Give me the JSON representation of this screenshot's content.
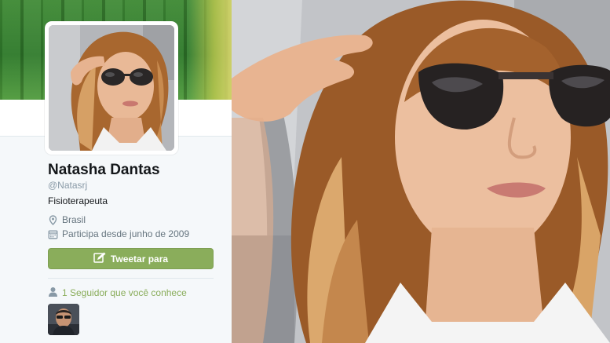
{
  "profile": {
    "name": "Natasha Dantas",
    "handle": "@Natasrj",
    "bio": "Fisioterapeuta",
    "location": "Brasil",
    "joined": "Participa desde junho de 2009",
    "tweet_button_label": "Tweetar para",
    "followers_you_know": "1 Seguidor que você conhece"
  },
  "icons": {
    "location": "map-pin-icon",
    "joined": "calendar-icon",
    "tweet": "compose-icon",
    "followers": "person-icon"
  },
  "colors": {
    "accent": "#8aad5b",
    "banner": "#3f8a35",
    "name": "#14171a",
    "secondary_text": "#66757f"
  }
}
